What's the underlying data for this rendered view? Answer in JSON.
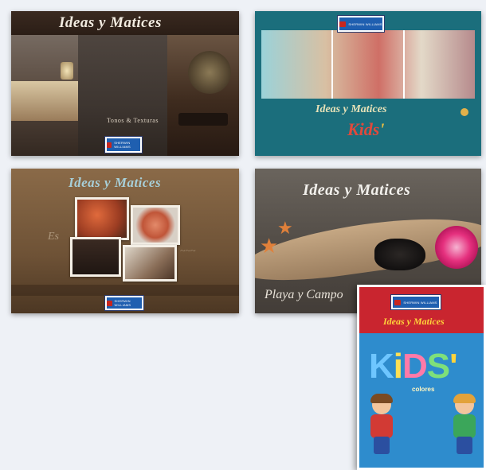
{
  "cards": {
    "card1": {
      "title": "Ideas y Matices",
      "subtitle": "Tonos & Texturas",
      "brand": "Sherwin Williams"
    },
    "card2": {
      "title": "Ideas y Matices",
      "kids": "Kids",
      "brand": "Sherwin Williams"
    },
    "card3": {
      "title": "Ideas y Matices",
      "brand": "Sherwin Williams"
    },
    "card4": {
      "title": "Ideas y Matices",
      "script": "Playa y Campo"
    },
    "card5": {
      "brand": "Sherwin Williams",
      "title": "Ideas y Matices",
      "kids_letters": [
        "K",
        "i",
        "D",
        "S",
        "'"
      ],
      "colores": "colores"
    }
  },
  "colors": {
    "page_background": "#eef1f6",
    "brand_blue": "#1f5fb0",
    "brand_red": "#c8261e",
    "kids_cover_blue": "#2e8ccd",
    "kids_cover_red": "#c9252f",
    "teal_card": "#1b6e7c"
  },
  "icons": {
    "starfish": "starfish-icon",
    "brand_logo": "sherwin-williams-logo-icon"
  }
}
